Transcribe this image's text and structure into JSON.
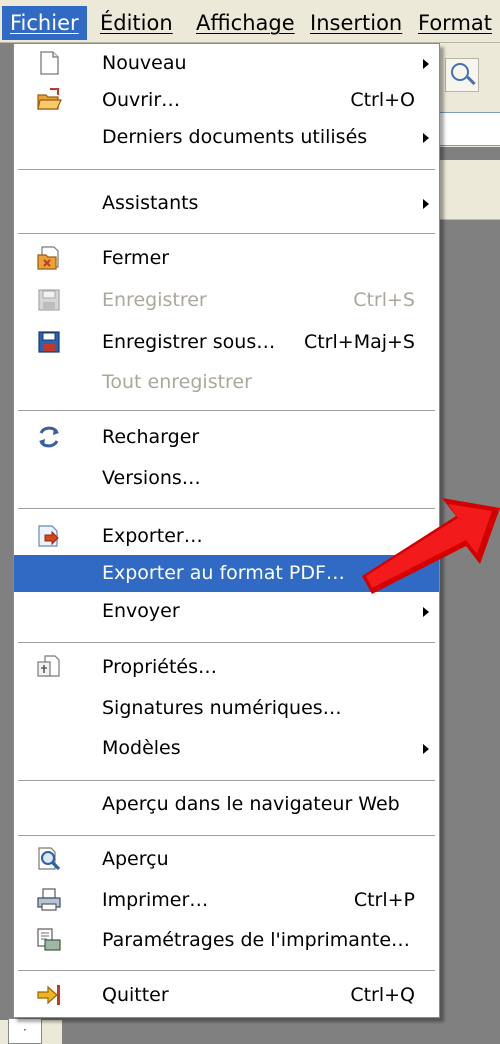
{
  "menubar": {
    "items": [
      {
        "label": "Fichier",
        "active": true
      },
      {
        "label": "Édition"
      },
      {
        "label": "Affichage"
      },
      {
        "label": "Insertion"
      },
      {
        "label": "Format"
      }
    ]
  },
  "file_menu": {
    "items": [
      {
        "label": "Nouveau",
        "icon": "new-document-icon",
        "submenu": true
      },
      {
        "label": "Ouvrir…",
        "icon": "open-folder-icon",
        "shortcut": "Ctrl+O"
      },
      {
        "label": "Derniers documents utilisés",
        "submenu": true
      },
      {
        "label": "Assistants",
        "submenu": true
      },
      {
        "label": "Fermer",
        "icon": "close-document-icon"
      },
      {
        "label": "Enregistrer",
        "icon": "save-disk-icon",
        "shortcut": "Ctrl+S",
        "disabled": true
      },
      {
        "label": "Enregistrer sous…",
        "icon": "save-as-disk-icon",
        "shortcut": "Ctrl+Maj+S"
      },
      {
        "label": "Tout enregistrer",
        "disabled": true
      },
      {
        "label": "Recharger",
        "icon": "reload-icon"
      },
      {
        "label": "Versions…"
      },
      {
        "label": "Exporter…",
        "icon": "export-icon"
      },
      {
        "label": "Exporter au format PDF…",
        "highlighted": true
      },
      {
        "label": "Envoyer",
        "submenu": true
      },
      {
        "label": "Propriétés…",
        "icon": "properties-icon"
      },
      {
        "label": "Signatures numériques…"
      },
      {
        "label": "Modèles",
        "submenu": true
      },
      {
        "label": "Aperçu dans le navigateur Web"
      },
      {
        "label": "Aperçu",
        "icon": "preview-magnifier-icon"
      },
      {
        "label": "Imprimer…",
        "icon": "printer-icon",
        "shortcut": "Ctrl+P"
      },
      {
        "label": "Paramétrages de l'imprimante…",
        "icon": "printer-settings-icon"
      },
      {
        "label": "Quitter",
        "icon": "exit-arrow-icon",
        "shortcut": "Ctrl+Q"
      }
    ]
  },
  "colors": {
    "highlight": "#316ac5",
    "menubar_bg": "#ece9d8",
    "disabled_text": "#aca899",
    "pointer_arrow": "#e00000"
  }
}
